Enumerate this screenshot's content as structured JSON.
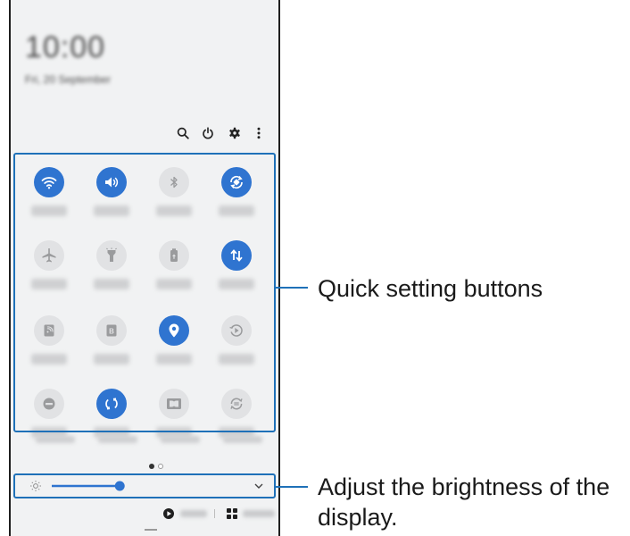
{
  "status_area": {
    "time": "10:00",
    "date": "Fri, 20 September"
  },
  "toolbar": {
    "icons": [
      "search-icon",
      "power-icon",
      "settings-gear-icon",
      "more-options-icon"
    ]
  },
  "quick_settings": {
    "tiles": [
      {
        "icon": "wifi-icon",
        "state": "on"
      },
      {
        "icon": "sound-icon",
        "state": "on"
      },
      {
        "icon": "bluetooth-icon",
        "state": "off"
      },
      {
        "icon": "auto-rotate-icon",
        "state": "on"
      },
      {
        "icon": "airplane-mode-icon",
        "state": "off"
      },
      {
        "icon": "flashlight-icon",
        "state": "off"
      },
      {
        "icon": "power-saving-icon",
        "state": "off"
      },
      {
        "icon": "mobile-data-icon",
        "state": "on"
      },
      {
        "icon": "mobile-hotspot-icon",
        "state": "off"
      },
      {
        "icon": "bixby-routines-icon",
        "state": "off"
      },
      {
        "icon": "location-icon",
        "state": "on"
      },
      {
        "icon": "screen-recorder-icon",
        "state": "off"
      },
      {
        "icon": "do-not-disturb-icon",
        "state": "off"
      },
      {
        "icon": "sync-icon",
        "state": "on"
      },
      {
        "icon": "dolby-atmos-icon",
        "state": "off"
      },
      {
        "icon": "smart-view-icon",
        "state": "off"
      }
    ],
    "page_indicator": {
      "pages": 2,
      "current": 1
    }
  },
  "brightness": {
    "level": 0.37,
    "sun_icon": "sun-icon",
    "expand_icon": "chevron-down-icon"
  },
  "bottom_bar": {
    "media_icon": "play-icon",
    "devices_icon": "grid-icon"
  },
  "callouts": {
    "quick_settings_label": "Quick setting buttons",
    "brightness_label_line1": "Adjust the brightness of the",
    "brightness_label_line2": "display."
  },
  "colors": {
    "accent": "#2f74d0",
    "callout": "#1f71b8",
    "tile_off": "#e1e2e4",
    "panel_bg": "#f1f2f3"
  }
}
